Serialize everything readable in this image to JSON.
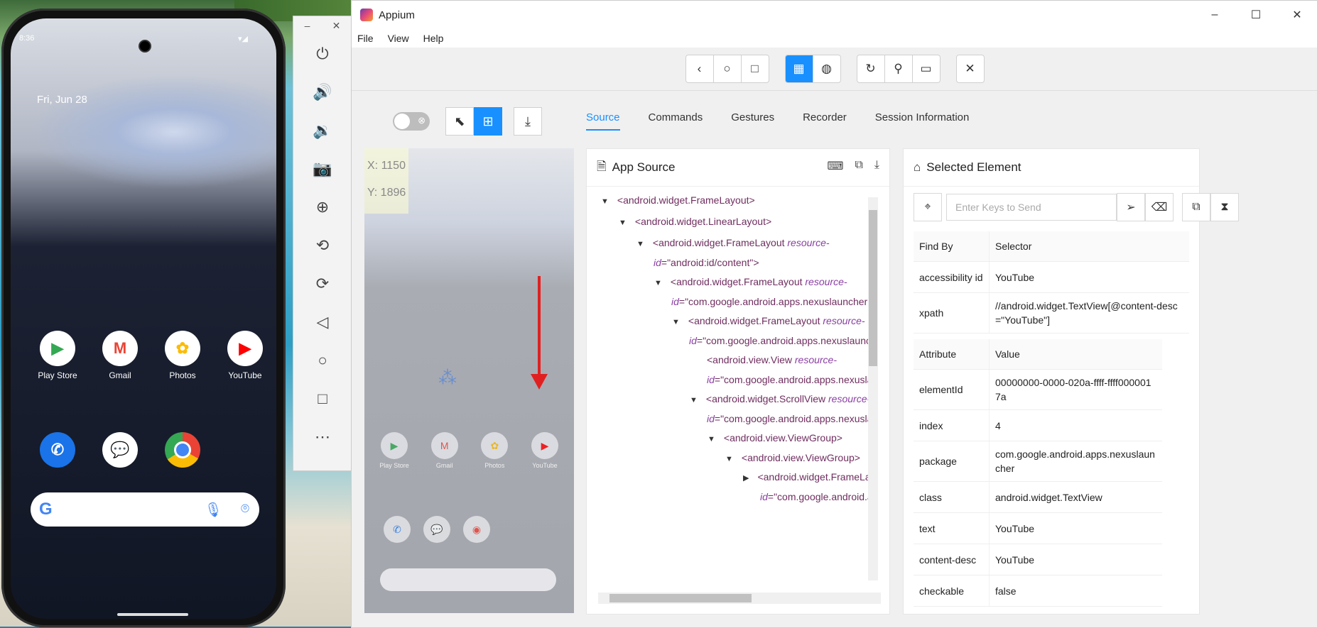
{
  "phone": {
    "time": "8:36",
    "date": "Fri, Jun 28",
    "apps_row1": [
      {
        "label": "Play Store",
        "icon": "play-store-icon",
        "glyph": "▶",
        "color": "#34a853"
      },
      {
        "label": "Gmail",
        "icon": "gmail-icon",
        "glyph": "M",
        "color": "#ea4335"
      },
      {
        "label": "Photos",
        "icon": "photos-icon",
        "glyph": "✿",
        "color": "#fbbc05"
      },
      {
        "label": "YouTube",
        "icon": "youtube-icon",
        "glyph": "▶",
        "color": "#ff0000"
      }
    ]
  },
  "window": {
    "title": "Appium"
  },
  "menu": [
    "File",
    "View",
    "Help"
  ],
  "tabs": [
    "Source",
    "Commands",
    "Gestures",
    "Recorder",
    "Session Information"
  ],
  "coords": {
    "x": "X: 1150",
    "y": "Y: 1896"
  },
  "mini_apps": [
    "Play Store",
    "Gmail",
    "Photos",
    "YouTube"
  ],
  "source": {
    "title": "App Source",
    "tree": [
      {
        "indent": 0,
        "caret": "▼",
        "tag": "<android.widget.FrameLayout>"
      },
      {
        "indent": 1,
        "caret": "▼",
        "tag": "<android.widget.LinearLayout>"
      },
      {
        "indent": 2,
        "caret": "▼",
        "tag": "<android.widget.FrameLayout ",
        "attr": "resource-"
      },
      {
        "indent": 2,
        "caret": "",
        "attr": "id",
        "rest": "=\"android:id/content\">"
      },
      {
        "indent": 3,
        "caret": "▼",
        "tag": "<android.widget.FrameLayout ",
        "attr": "resource-"
      },
      {
        "indent": 3,
        "caret": "",
        "attr": "id",
        "rest": "=\"com.google.android.apps.nexuslauncher:id/la"
      },
      {
        "indent": 4,
        "caret": "▼",
        "tag": "<android.widget.FrameLayout ",
        "attr": "resource-"
      },
      {
        "indent": 4,
        "caret": "",
        "attr": "id",
        "rest": "=\"com.google.android.apps.nexuslauncher:"
      },
      {
        "indent": 5,
        "caret": "",
        "tag": "<android.view.View ",
        "attr": "resource-"
      },
      {
        "indent": 5,
        "caret": "",
        "attr": "id",
        "rest": "=\"com.google.android.apps.nexuslaun"
      },
      {
        "indent": 5,
        "caret": "▼",
        "tag": "<android.widget.ScrollView ",
        "attr": "resource-"
      },
      {
        "indent": 5,
        "caret": "",
        "attr": "id",
        "rest": "=\"com.google.android.apps.nexuslaun"
      },
      {
        "indent": 6,
        "caret": "▼",
        "tag": "<android.view.ViewGroup>"
      },
      {
        "indent": 7,
        "caret": "▼",
        "tag": "<android.view.ViewGroup>"
      },
      {
        "indent": 8,
        "caret": "▶",
        "tag": "<android.widget.FrameLay"
      },
      {
        "indent": 8,
        "caret": "",
        "attr": "id",
        "rest": "=\"com.google.android.ap"
      }
    ]
  },
  "selected": {
    "title": "Selected Element",
    "keys_placeholder": "Enter Keys to Send",
    "find_headers": [
      "Find By",
      "Selector"
    ],
    "find_rows": [
      [
        "accessibility id",
        "YouTube"
      ],
      [
        "xpath",
        "//android.widget.TextView[@content-desc=\"YouTube\"]"
      ]
    ],
    "attr_headers": [
      "Attribute",
      "Value"
    ],
    "attr_rows": [
      [
        "elementId",
        "00000000-0000-020a-ffff-ffff0000017a"
      ],
      [
        "index",
        "4"
      ],
      [
        "package",
        "com.google.android.apps.nexuslauncher"
      ],
      [
        "class",
        "android.widget.TextView"
      ],
      [
        "text",
        "YouTube"
      ],
      [
        "content-desc",
        "YouTube"
      ],
      [
        "checkable",
        "false"
      ]
    ]
  },
  "colors": {
    "accent": "#1890ff",
    "arrow": "#e02020"
  }
}
